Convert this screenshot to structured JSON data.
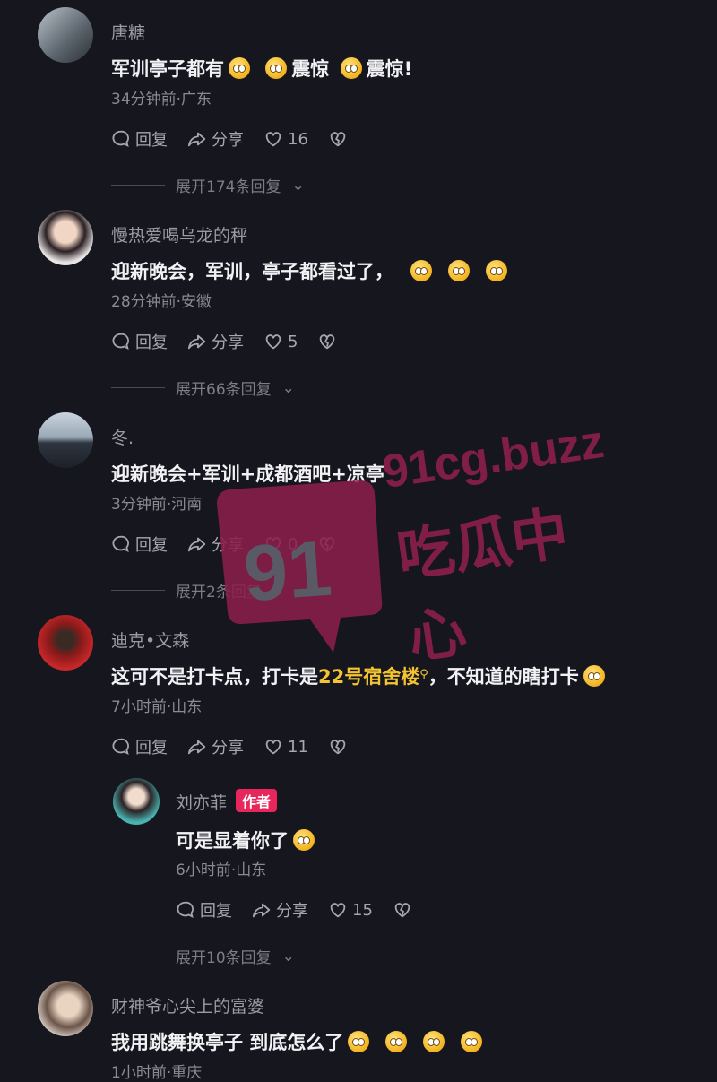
{
  "comments": [
    {
      "username": "唐糖",
      "text_before": "军训亭子都有",
      "text_after": "震惊",
      "text_after2": "震惊!",
      "meta": "34分钟前·广东",
      "reply": "回复",
      "share": "分享",
      "likes": "16",
      "expand": "展开174条回复"
    },
    {
      "username": "慢热爱喝乌龙的秤",
      "text": "迎新晚会，军训，亭子都看过了，",
      "meta": "28分钟前·安徽",
      "reply": "回复",
      "share": "分享",
      "likes": "5",
      "expand": "展开66条回复"
    },
    {
      "username": "冬.",
      "text": "迎新晚会+军训+成都酒吧+凉亭",
      "meta": "3分钟前·河南",
      "reply": "回复",
      "share": "分享",
      "likes": "0",
      "expand": "展开2条回复"
    },
    {
      "username": "迪克•文森",
      "text_a": "这可不是打卡点，打卡是",
      "text_link": "22号宿舍楼",
      "text_b": "，不知道的瞎打卡",
      "meta": "7小时前·山东",
      "reply": "回复",
      "share": "分享",
      "likes": "11"
    },
    {
      "username": "刘亦菲",
      "tag": "作者",
      "text": "可是显着你了",
      "meta": "6小时前·山东",
      "reply": "回复",
      "share": "分享",
      "likes": "15",
      "expand": "展开10条回复"
    },
    {
      "username": "财神爷心尖上的富婆",
      "text": "我用跳舞换亭子 到底怎么了",
      "meta": "1小时前·重庆"
    }
  ],
  "watermark": {
    "number": "91",
    "domain": "91cg.buzz",
    "name": "吃瓜中心"
  },
  "colors": {
    "background": "#16161f",
    "accent_tag": "#e8265b",
    "link": "#f5c531",
    "watermark": "#8a1f4a"
  }
}
